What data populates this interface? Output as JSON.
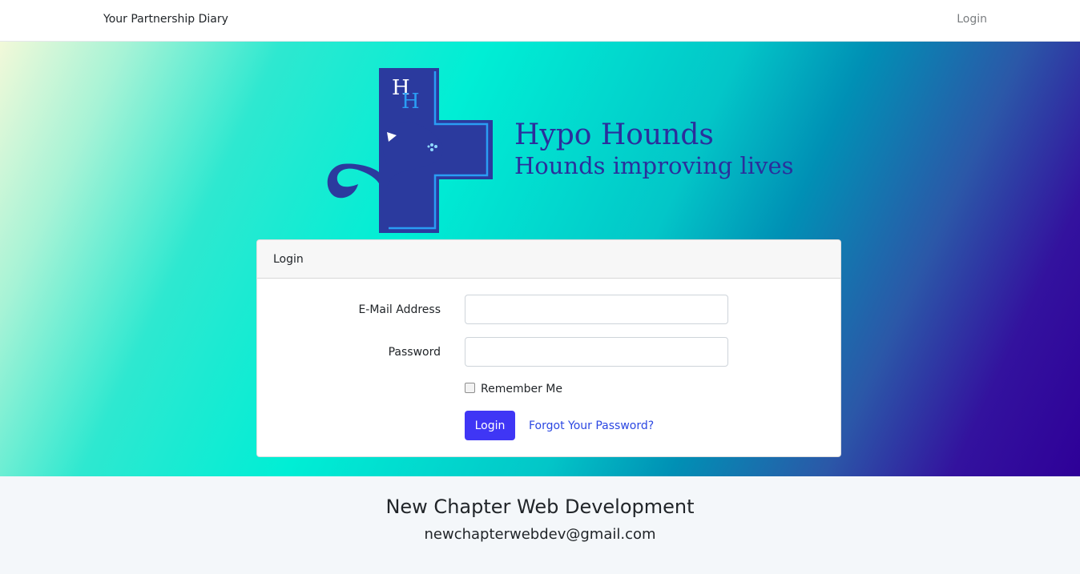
{
  "navbar": {
    "brand": "Your Partnership Diary",
    "login_link": "Login"
  },
  "logo": {
    "monogram_top": "H",
    "monogram_bottom": "H",
    "title": "Hypo Hounds",
    "tagline": "Hounds improving lives",
    "colors": {
      "navy": "#2b3a9e",
      "light_blue": "#2a9df4"
    }
  },
  "login_card": {
    "header": "Login",
    "email_label": "E-Mail Address",
    "email_value": "",
    "password_label": "Password",
    "password_value": "",
    "remember_label": "Remember Me",
    "remember_checked": false,
    "submit_label": "Login",
    "forgot_link": "Forgot Your Password?"
  },
  "footer": {
    "company": "New Chapter Web Development",
    "email": "newchapterwebdev@gmail.com"
  },
  "colors": {
    "accent_button": "#3f36f5",
    "link": "#2b47e2",
    "gradient_start": "#f2f9d9",
    "gradient_mid": "#00eed5",
    "gradient_end": "#2e0098"
  }
}
